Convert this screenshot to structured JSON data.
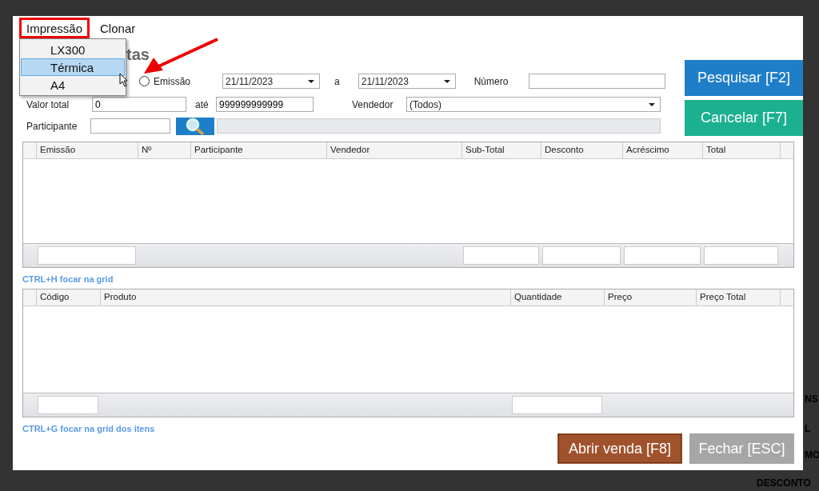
{
  "background_texts": [
    "NS",
    "L",
    "MO",
    "DESCONTO"
  ],
  "menu": [
    {
      "label": "Impressão",
      "open": true,
      "items": [
        {
          "label": "LX300",
          "selected": false
        },
        {
          "label": "Térmica",
          "selected": true
        },
        {
          "label": "A4",
          "selected": false
        }
      ]
    },
    {
      "label": "Clonar",
      "open": false
    }
  ],
  "title": "tas",
  "filters": {
    "date_radio": {
      "label": "Emissão",
      "checked": false
    },
    "date_from": "21/11/2023",
    "between": "a",
    "date_to": "21/11/2023",
    "number_label": "Número",
    "total_label": "Valor total",
    "total_from": "0",
    "until": "até",
    "total_to": "999999999999",
    "seller_label": "Vendedor",
    "seller": "(Todos)",
    "participant_label": "Participante"
  },
  "buttons": {
    "search": "Pesquisar [F2]",
    "cancel": "Cancelar [F7]",
    "open_sale": "Abrir venda [F8]",
    "close": "Fechar [ESC]"
  },
  "sales_grid": {
    "columns": [
      {
        "label": "Emissão",
        "has_total": true
      },
      {
        "label": "Nº",
        "has_total": false
      },
      {
        "label": "Participante",
        "has_total": false
      },
      {
        "label": "Vendedor",
        "has_total": false
      },
      {
        "label": "Sub-Total",
        "has_total": true
      },
      {
        "label": "Desconto",
        "has_total": true
      },
      {
        "label": "Acréscimo",
        "has_total": true
      },
      {
        "label": "Total",
        "has_total": true
      }
    ],
    "hint": "CTRL+H focar na grid"
  },
  "items_grid": {
    "columns": [
      {
        "label": "Código",
        "has_total": true
      },
      {
        "label": "Produto",
        "has_total": false
      },
      {
        "label": "Quantidade",
        "has_total": true
      },
      {
        "label": "Preço",
        "has_total": false
      },
      {
        "label": "Preço Total",
        "has_total": false
      }
    ],
    "hint": "CTRL+G focar na grid dos itens"
  }
}
